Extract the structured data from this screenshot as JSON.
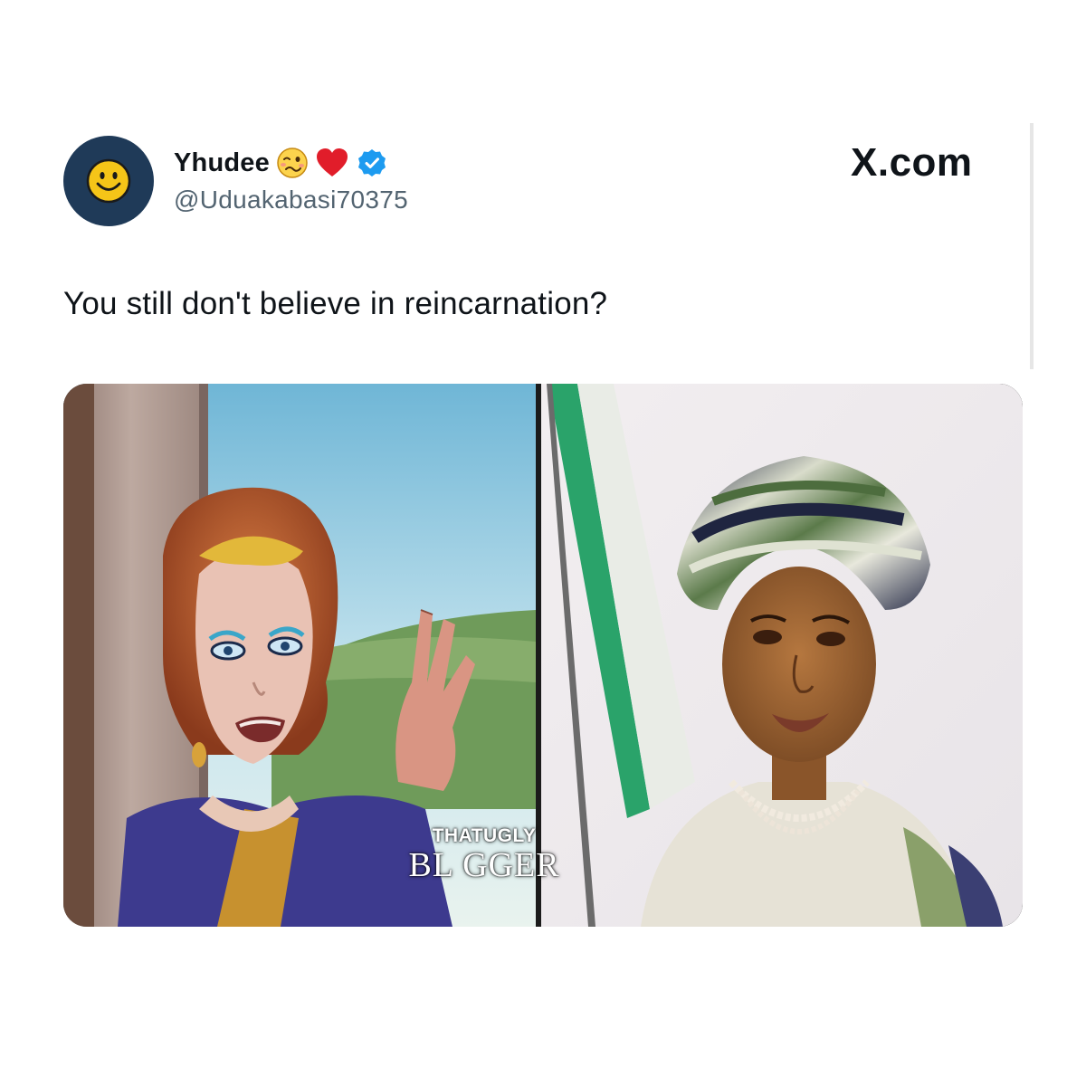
{
  "tweet": {
    "display_name": "Yhudee",
    "handle": "@Uduakabasi70375",
    "name_emojis": [
      "woozy-face-icon",
      "red-heart-icon"
    ],
    "verified": true,
    "text": "You still don't believe in reincarnation?"
  },
  "brand": {
    "label": "X.com"
  },
  "media": {
    "left_panel": "painting-illustration",
    "right_panel": "photo-portrait",
    "watermark_top": "THATUGLY",
    "watermark_bottom": "BL GGER"
  },
  "colors": {
    "avatar_bg": "#1f3a58",
    "avatar_face": "#f5c518",
    "verified_badge": "#1d9bf0",
    "handle_text": "#536471",
    "main_text": "#0f1419"
  }
}
